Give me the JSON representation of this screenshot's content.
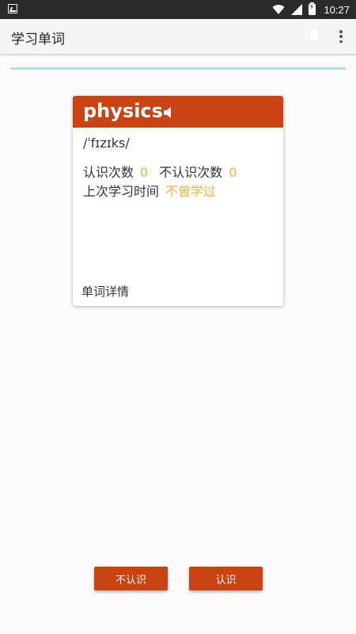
{
  "status_bar": {
    "time": "10:27",
    "icons": [
      "image-icon",
      "wifi-icon",
      "signal-icon",
      "battery-charging-icon"
    ]
  },
  "app_bar": {
    "title": "学习单词",
    "icons": [
      "blank-square-icon",
      "overflow-menu-icon"
    ]
  },
  "progress": {
    "fraction": 1.0,
    "color": "#b2dfdb"
  },
  "card": {
    "word": "physics",
    "phonetic": "/ˈfɪzɪks/",
    "known_label": "认识次数",
    "known_count": "0",
    "unknown_label": "不认识次数",
    "unknown_count": "0",
    "last_study_label": "上次学习时间",
    "last_study_value": "不曾学过",
    "detail_label": "单词详情",
    "header_color": "#cb4213",
    "accent_color": "#f3b23a"
  },
  "buttons": {
    "unknown_label": "不认识",
    "known_label": "认识"
  }
}
